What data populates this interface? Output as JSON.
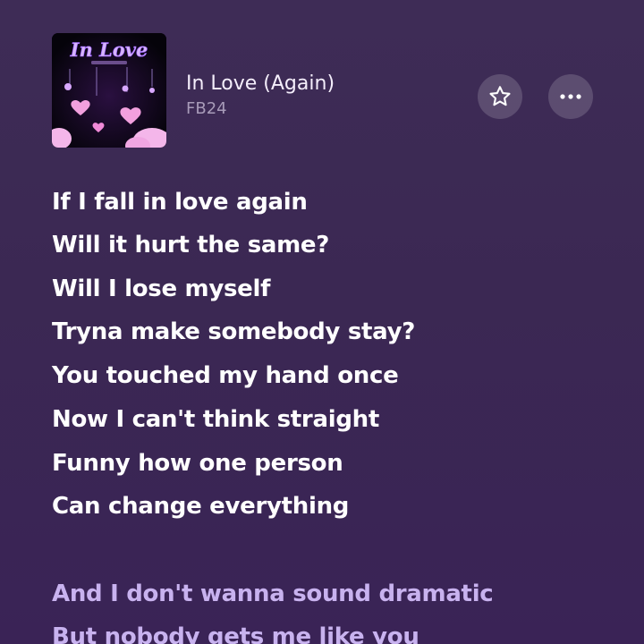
{
  "track": {
    "title": "In Love (Again)",
    "artist": "FB24",
    "cover_text": "In Love"
  },
  "actions": {
    "favorite_icon": "star-icon",
    "more_icon": "ellipsis-icon"
  },
  "lyrics": {
    "current_verse": [
      "If I fall in love again",
      "Will it hurt the same?",
      "Will I lose myself",
      "Tryna make somebody stay?",
      "You touched my hand once",
      "Now I can't think straight",
      "Funny how one person",
      "Can change everything"
    ],
    "next_verse": [
      "And I don't wanna sound dramatic",
      "But nobody gets me like you"
    ]
  },
  "colors": {
    "background": "#3c2854",
    "active_lyric": "#ffffff",
    "upcoming_lyric": "#c8b2ef",
    "cover_neon": "#c08cff"
  }
}
